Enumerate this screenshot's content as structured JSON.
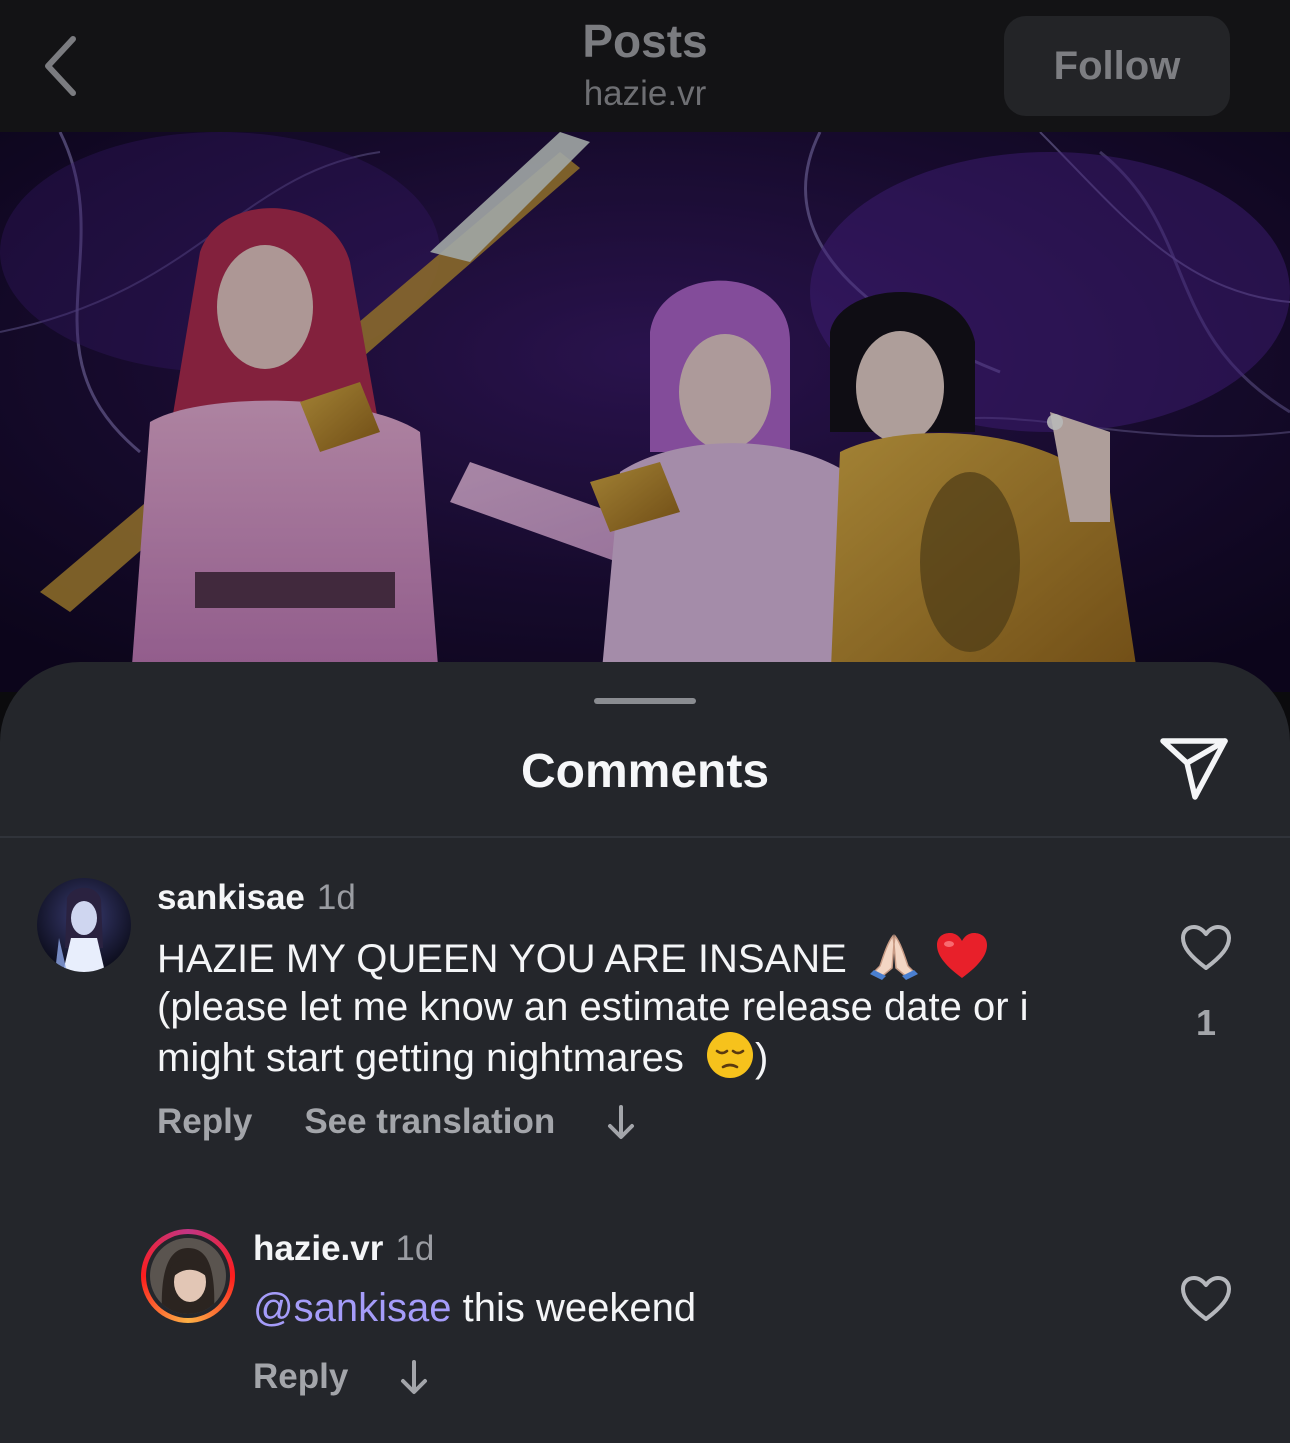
{
  "nav": {
    "title": "Posts",
    "subtitle": "hazie.vr",
    "follow_label": "Follow"
  },
  "sheet": {
    "title": "Comments"
  },
  "comments": [
    {
      "username": "sankisae",
      "time": "1d",
      "line1": "HAZIE MY QUEEN YOU ARE INSANE",
      "line2": "(please let me know an estimate release date or i",
      "line3": "might start getting nightmares",
      "line3_end": ")",
      "emojis": [
        "folded-hands-emoji",
        "red-heart-emoji",
        "pensive-face-emoji"
      ],
      "like_count": "1",
      "reply_label": "Reply",
      "translate_label": "See translation"
    },
    {
      "username": "hazie.vr",
      "time": "1d",
      "mention": "@sankisae",
      "text": "this weekend",
      "reply_label": "Reply"
    }
  ],
  "colors": {
    "sheet_bg": "#24262b",
    "mention": "#a59cf9",
    "muted_text": "#a3a5aa",
    "story_ring": [
      "#fcb045",
      "#fd1d1d",
      "#c13584"
    ]
  }
}
